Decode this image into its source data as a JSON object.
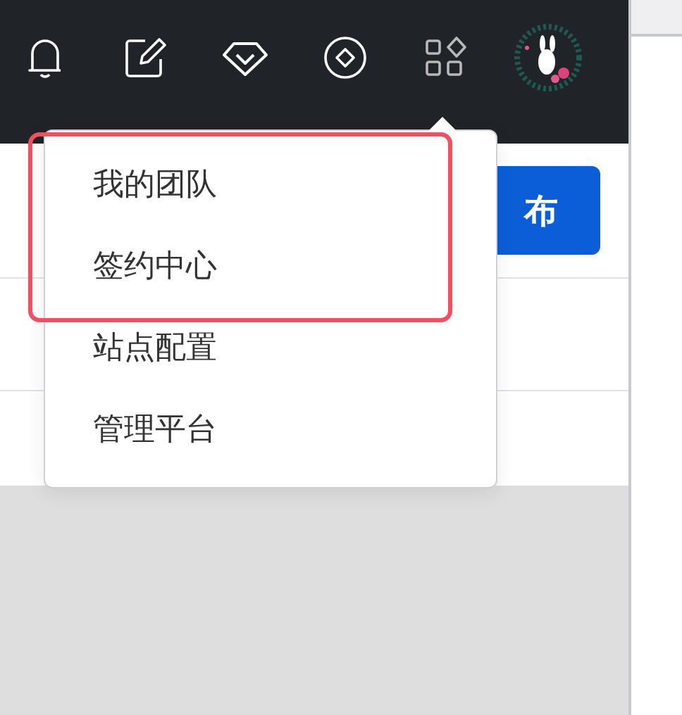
{
  "header": {
    "icons": [
      {
        "kind": "bell"
      },
      {
        "kind": "edit"
      },
      {
        "kind": "gem"
      },
      {
        "kind": "diamond"
      },
      {
        "kind": "apps"
      }
    ]
  },
  "publish_button": {
    "label": "布"
  },
  "menu": {
    "items": [
      {
        "label": "我的团队",
        "annotated": true
      },
      {
        "label": "签约中心",
        "annotated": true
      },
      {
        "label": "站点配置",
        "annotated": false
      },
      {
        "label": "管理平台",
        "annotated": false
      }
    ]
  }
}
